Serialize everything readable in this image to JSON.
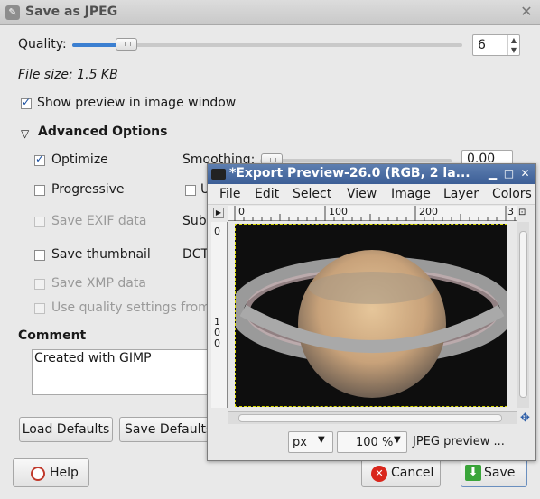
{
  "dialog": {
    "title": "Save as JPEG",
    "quality_label": "Quality:",
    "quality_value": "6",
    "quality_fraction": 0.06,
    "file_size": "File size: 1.5 KB",
    "show_preview": "Show preview in image window",
    "advanced_options": "Advanced Options",
    "optimize": "Optimize",
    "smoothing_label": "Smoothing:",
    "smoothing_value": "0.00",
    "progressive": "Progressive",
    "progressive_right_partial": "U",
    "save_exif": "Save EXIF data",
    "subsampling_partial": "Subs",
    "save_thumbnail": "Save thumbnail",
    "dct_partial": "DCT",
    "save_xmp": "Save XMP data",
    "use_quality": "Use quality settings from",
    "comment_label": "Comment",
    "comment_text": "Created with GIMP",
    "load_defaults": "Load Defaults",
    "save_defaults": "Save Defaults",
    "help": "Help",
    "cancel": "Cancel",
    "save": "Save"
  },
  "preview": {
    "title": "*Export Preview-26.0 (RGB, 2 la...",
    "menu": [
      "File",
      "Edit",
      "Select",
      "View",
      "Image",
      "Layer",
      "Colors"
    ],
    "ruler_h": [
      "0",
      "100",
      "200",
      "3"
    ],
    "ruler_v": [
      "0",
      "1",
      "0",
      "0"
    ],
    "unit": "px",
    "zoom": "100 %",
    "status": "JPEG preview ..."
  },
  "colors": {
    "accent": "#3b7fd1",
    "cancel_red": "#d9261c",
    "save_green": "#3aa53a"
  }
}
